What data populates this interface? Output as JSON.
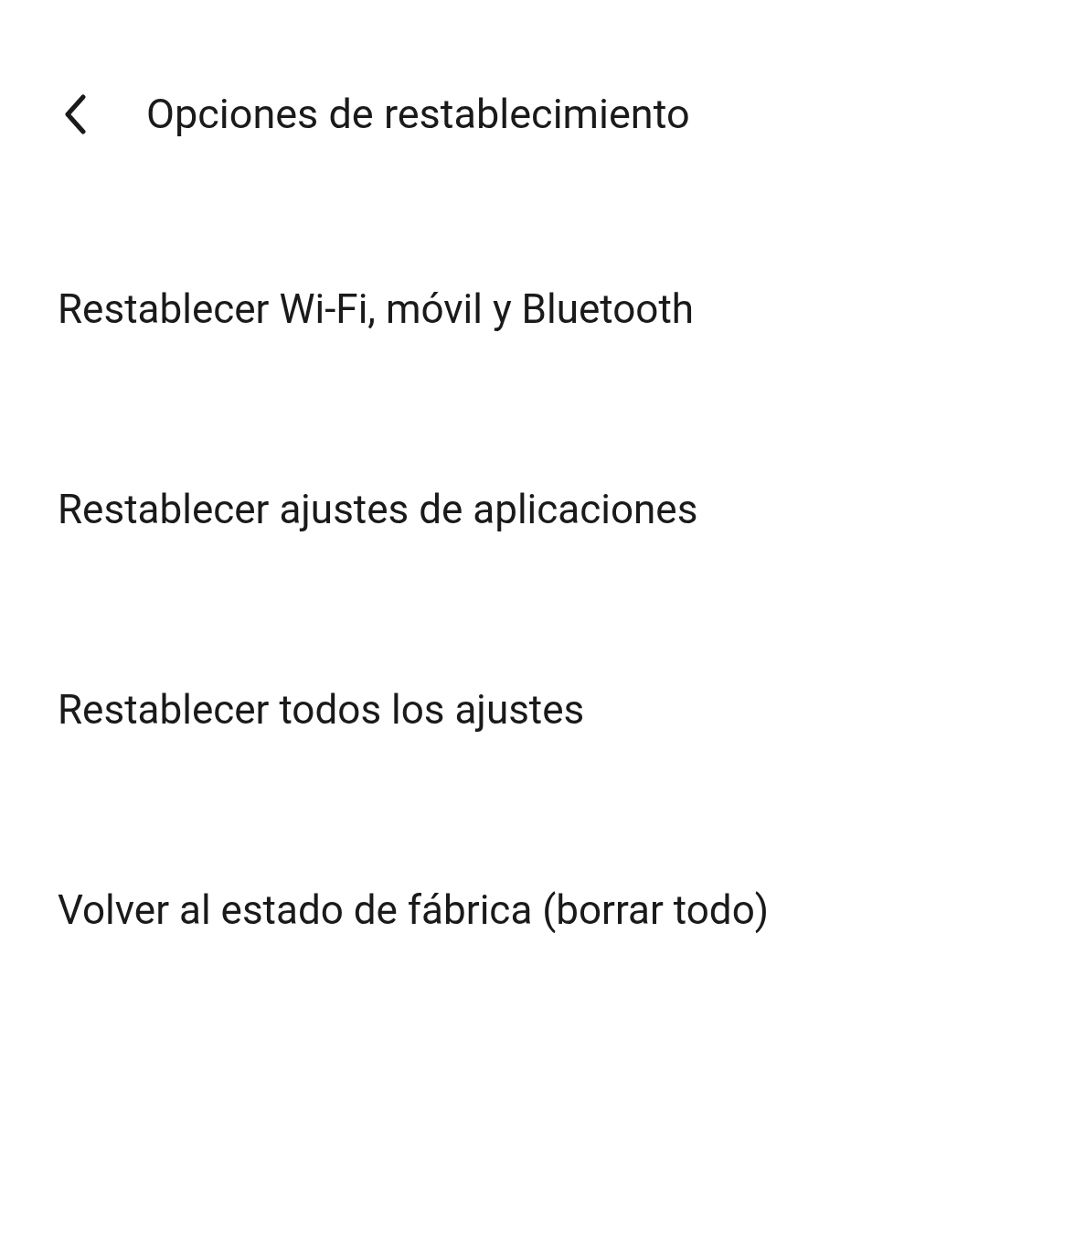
{
  "header": {
    "title": "Opciones de restablecimiento"
  },
  "items": [
    {
      "label": "Restablecer Wi-Fi, móvil y Bluetooth"
    },
    {
      "label": "Restablecer ajustes de aplicaciones"
    },
    {
      "label": "Restablecer todos los ajustes"
    },
    {
      "label": "Volver al estado de fábrica (borrar todo)"
    }
  ]
}
